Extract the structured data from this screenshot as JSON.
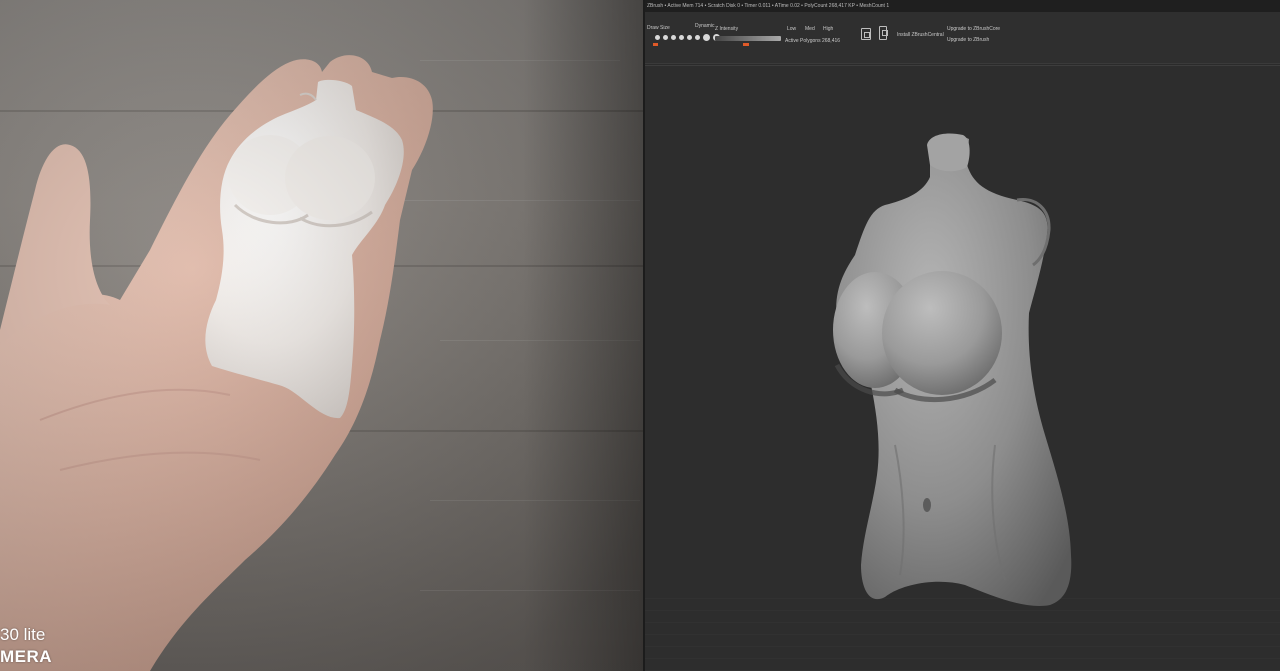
{
  "photo": {
    "watermark_line1": "30 lite",
    "watermark_line2": "MERA"
  },
  "app": {
    "titlebar_text": "ZBrush • Active Mem 714 • Scratch Disk 0 • Timer 0.011 • ATime 0.02 • PolyCount 268,417 KP • MeshCount 1",
    "toolbar": {
      "draw_size_label": "Draw Size",
      "dynamic_label": "Dynamic",
      "z_intensity_label": "Z Intensity",
      "low_label": "Low",
      "med_label": "Med",
      "high_label": "High",
      "active_polygons_label": "Active Polygons 268,416",
      "hotkey_label": "Install ZBrushCentral",
      "upgrade1_label": "Upgrade to ZBrushCore",
      "upgrade2_label": "Upgrade to ZBrush"
    }
  },
  "colors": {
    "accent": "#e05a28",
    "app_background": "#2b2b2b",
    "toolbar_background": "#2f2f2f"
  }
}
